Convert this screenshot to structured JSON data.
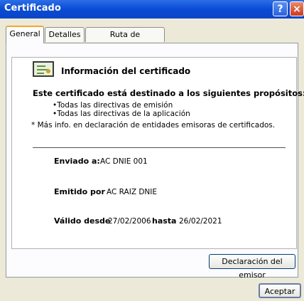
{
  "window": {
    "title": "Certificado"
  },
  "titlebar": {
    "help_label": "?",
    "close_label": "×"
  },
  "tabs": [
    {
      "label": "General",
      "active": true
    },
    {
      "label": "Detalles",
      "active": false
    },
    {
      "label": "Ruta de certificación",
      "active": false
    }
  ],
  "general": {
    "info_title": "Información del certificado",
    "purposes_heading": "Este certificado está destinado a los siguientes propósitos:",
    "purposes": [
      "•Todas las directivas de emisión",
      "•Todas las directivas de la aplicación"
    ],
    "more_info": "* Más info. en declaración de entidades emisoras de certificados.",
    "issued_to_label": "Enviado a:",
    "issued_to_value": "AC DNIE 001",
    "issued_by_label": "Emitido por",
    "issued_by_value": "AC RAIZ DNIE",
    "valid_from_label": "Válido desde",
    "valid_from_value": "27/02/2006",
    "valid_to_label": "hasta",
    "valid_to_value": "26/02/2021"
  },
  "buttons": {
    "issuer_statement": "Declaración del emisor",
    "accept": "Aceptar"
  },
  "colors": {
    "titlebar": "#0a4bd4",
    "dialog_bg": "#ece9d8",
    "active_tab_accent": "#f7a822"
  }
}
